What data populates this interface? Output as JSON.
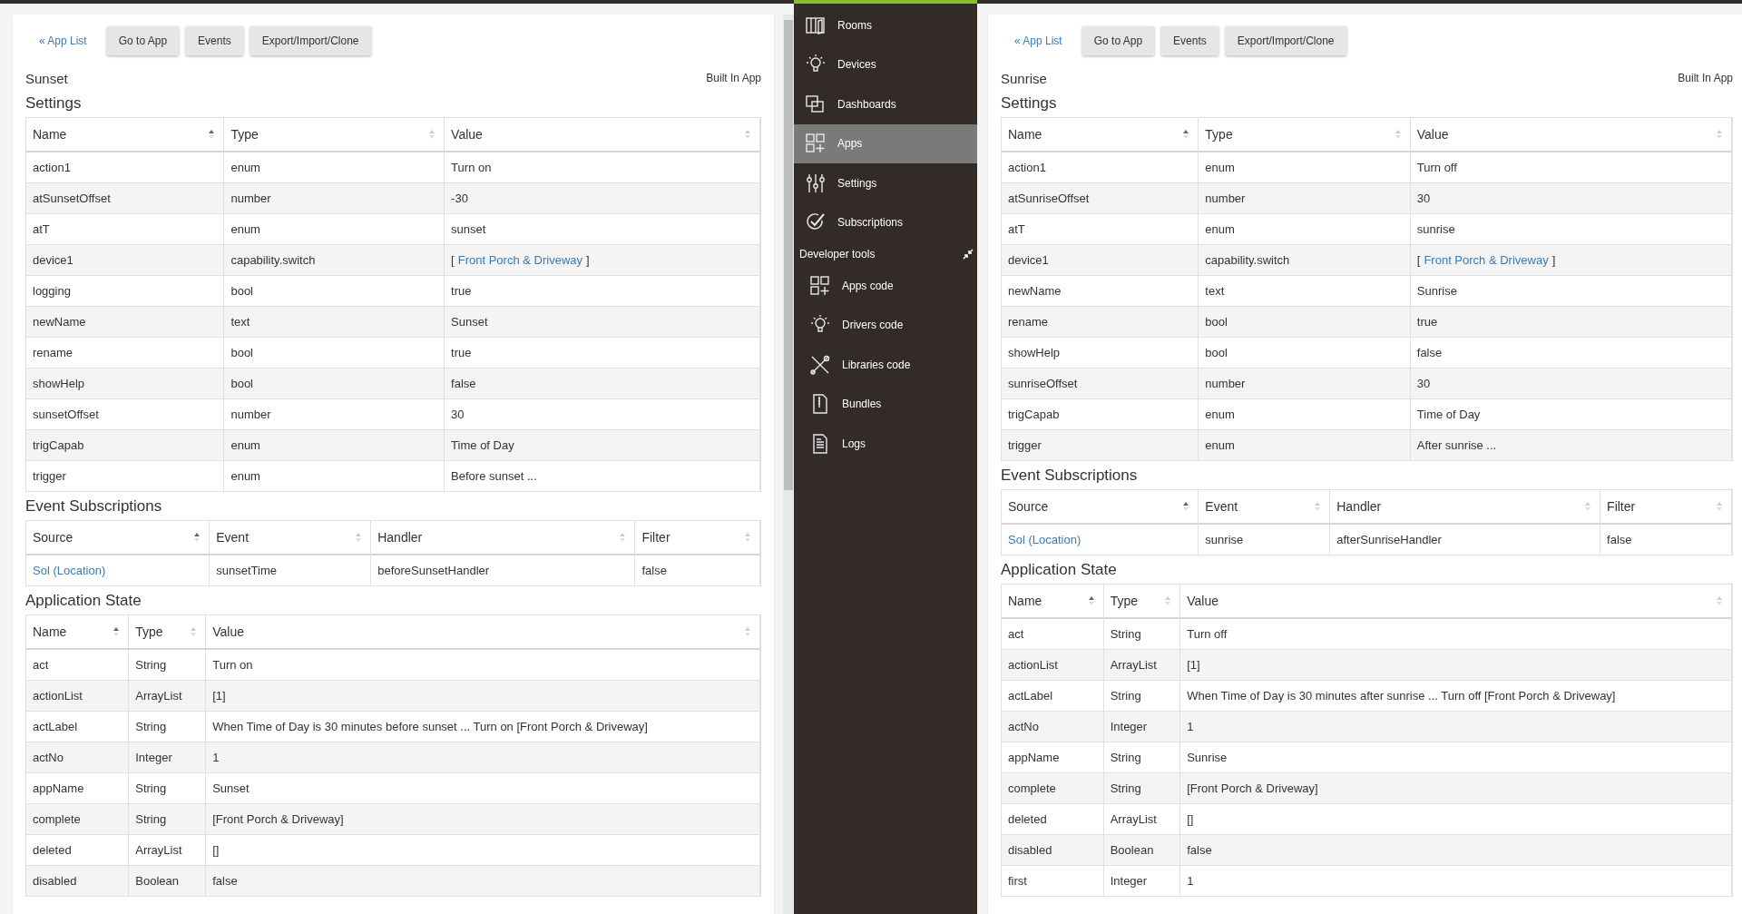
{
  "panes": [
    {
      "nav": {
        "back_link": "« App List",
        "buttons": [
          "Go to App",
          "Events",
          "Export/Import/Clone"
        ]
      },
      "app_name": "Sunset",
      "app_type": "Built In App",
      "settings": {
        "title": "Settings",
        "columns": [
          "Name",
          "Type",
          "Value"
        ],
        "rows": [
          [
            "action1",
            "enum",
            "Turn on"
          ],
          [
            "atSunsetOffset",
            "number",
            "-30"
          ],
          [
            "atT",
            "enum",
            "sunset"
          ],
          [
            "device1",
            "capability.switch",
            {
              "before": "[",
              "link": "Front Porch & Driveway",
              "after": "]"
            }
          ],
          [
            "logging",
            "bool",
            "true"
          ],
          [
            "newName",
            "text",
            "Sunset"
          ],
          [
            "rename",
            "bool",
            "true"
          ],
          [
            "showHelp",
            "bool",
            "false"
          ],
          [
            "sunsetOffset",
            "number",
            "30"
          ],
          [
            "trigCapab",
            "enum",
            "Time of Day"
          ],
          [
            "trigger",
            "enum",
            "Before sunset ..."
          ]
        ]
      },
      "subscriptions": {
        "title": "Event Subscriptions",
        "columns": [
          "Source",
          "Event",
          "Handler",
          "Filter"
        ],
        "rows": [
          [
            {
              "link": "Sol (Location)"
            },
            "sunsetTime",
            "beforeSunsetHandler",
            "false"
          ]
        ]
      },
      "state": {
        "title": "Application State",
        "columns": [
          "Name",
          "Type",
          "Value"
        ],
        "rows": [
          [
            "act",
            "String",
            "Turn on"
          ],
          [
            "actionList",
            "ArrayList",
            "[1]"
          ],
          [
            "actLabel",
            "String",
            "When Time of Day is 30 minutes before sunset ... Turn on [Front Porch & Driveway]"
          ],
          [
            "actNo",
            "Integer",
            "1"
          ],
          [
            "appName",
            "String",
            "Sunset"
          ],
          [
            "complete",
            "String",
            "[Front Porch & Driveway]"
          ],
          [
            "deleted",
            "ArrayList",
            "[]"
          ],
          [
            "disabled",
            "Boolean",
            "false"
          ]
        ]
      }
    },
    {
      "nav": {
        "back_link": "« App List",
        "buttons": [
          "Go to App",
          "Events",
          "Export/Import/Clone"
        ]
      },
      "app_name": "Sunrise",
      "app_type": "Built In App",
      "settings": {
        "title": "Settings",
        "columns": [
          "Name",
          "Type",
          "Value"
        ],
        "rows": [
          [
            "action1",
            "enum",
            "Turn off"
          ],
          [
            "atSunriseOffset",
            "number",
            "30"
          ],
          [
            "atT",
            "enum",
            "sunrise"
          ],
          [
            "device1",
            "capability.switch",
            {
              "before": "[",
              "link": "Front Porch & Driveway",
              "after": "]"
            }
          ],
          [
            "newName",
            "text",
            "Sunrise"
          ],
          [
            "rename",
            "bool",
            "true"
          ],
          [
            "showHelp",
            "bool",
            "false"
          ],
          [
            "sunriseOffset",
            "number",
            "30"
          ],
          [
            "trigCapab",
            "enum",
            "Time of Day"
          ],
          [
            "trigger",
            "enum",
            "After sunrise ..."
          ]
        ]
      },
      "subscriptions": {
        "title": "Event Subscriptions",
        "columns": [
          "Source",
          "Event",
          "Handler",
          "Filter"
        ],
        "rows": [
          [
            {
              "link": "Sol (Location)"
            },
            "sunrise",
            "afterSunriseHandler",
            "false"
          ]
        ]
      },
      "state": {
        "title": "Application State",
        "columns": [
          "Name",
          "Type",
          "Value"
        ],
        "rows": [
          [
            "act",
            "String",
            "Turn off"
          ],
          [
            "actionList",
            "ArrayList",
            "[1]"
          ],
          [
            "actLabel",
            "String",
            "When Time of Day is 30 minutes after sunrise ... Turn off [Front Porch & Driveway]"
          ],
          [
            "actNo",
            "Integer",
            "1"
          ],
          [
            "appName",
            "String",
            "Sunrise"
          ],
          [
            "complete",
            "String",
            "[Front Porch & Driveway]"
          ],
          [
            "deleted",
            "ArrayList",
            "[]"
          ],
          [
            "disabled",
            "Boolean",
            "false"
          ],
          [
            "first",
            "Integer",
            "1"
          ]
        ]
      }
    }
  ],
  "sidebar": {
    "items": [
      {
        "kind": "rooms",
        "label": "Rooms",
        "selected": false
      },
      {
        "kind": "devices",
        "label": "Devices",
        "selected": false
      },
      {
        "kind": "dashboards",
        "label": "Dashboards",
        "selected": false
      },
      {
        "kind": "apps",
        "label": "Apps",
        "selected": true
      },
      {
        "kind": "settings",
        "label": "Settings",
        "selected": false
      },
      {
        "kind": "subscriptions",
        "label": "Subscriptions",
        "selected": false
      }
    ],
    "section": "Developer tools",
    "dev_items": [
      {
        "kind": "apps",
        "label": "Apps code",
        "selected": false
      },
      {
        "kind": "devices",
        "label": "Drivers code",
        "selected": false
      },
      {
        "kind": "libraries",
        "label": "Libraries code",
        "selected": false
      },
      {
        "kind": "bundles",
        "label": "Bundles",
        "selected": false
      },
      {
        "kind": "logs",
        "label": "Logs",
        "selected": false
      }
    ]
  }
}
